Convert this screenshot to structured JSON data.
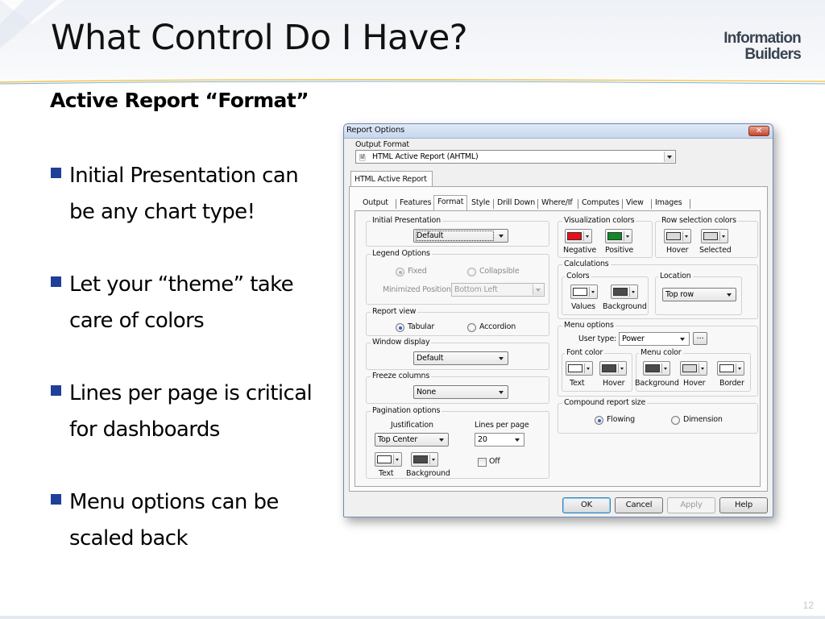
{
  "slide": {
    "title": "What Control Do I Have?",
    "subtitle": "Active Report “Format”",
    "logo_line1": "Information",
    "logo_line2": "Builders",
    "page_number": "12",
    "bullets": [
      {
        "line1": "Initial Presentation can",
        "line2": "be any chart type!"
      },
      {
        "line1": "Let your “theme” take",
        "line2": "care of colors"
      },
      {
        "line1": "Lines per page is critical",
        "line2": "for dashboards"
      },
      {
        "line1": "Menu options can be",
        "line2": "scaled back"
      }
    ]
  },
  "dialog": {
    "title": "Report Options",
    "output_format_label": "Output Format",
    "output_format_value": "HTML Active Report (AHTML)",
    "outer_tab": "HTML Active Report",
    "tabs": [
      "Output",
      "Features",
      "Format",
      "Style",
      "Drill Down",
      "Where/If",
      "Computes",
      "View",
      "Images"
    ],
    "selected_tab": "Format",
    "initial_presentation": {
      "title": "Initial Presentation",
      "value": "Default"
    },
    "legend_options": {
      "title": "Legend Options",
      "fixed": "Fixed",
      "collapsible": "Collapsible",
      "min_pos_label": "Minimized Position:",
      "min_pos_value": "Bottom Left"
    },
    "report_view": {
      "title": "Report view",
      "tabular": "Tabular",
      "accordion": "Accordion"
    },
    "window_display": {
      "title": "Window display",
      "value": "Default"
    },
    "freeze_columns": {
      "title": "Freeze columns",
      "value": "None"
    },
    "pagination": {
      "title": "Pagination options",
      "justification_label": "Justification",
      "justification_value": "Top Center",
      "lines_label": "Lines per page",
      "lines_value": "20",
      "text": "Text",
      "background": "Background",
      "off": "Off"
    },
    "visualization_colors": {
      "title": "Visualization colors",
      "negative": "Negative",
      "positive": "Positive"
    },
    "row_selection_colors": {
      "title": "Row selection colors",
      "hover": "Hover",
      "selected": "Selected"
    },
    "calculations": {
      "title": "Calculations",
      "colors_title": "Colors",
      "values": "Values",
      "background": "Background",
      "location_title": "Location",
      "location_value": "Top row"
    },
    "menu_options": {
      "title": "Menu options",
      "user_type_label": "User type:",
      "user_type_value": "Power",
      "ellipsis": "...",
      "font_color_title": "Font color",
      "menu_color_title": "Menu color",
      "text": "Text",
      "hover": "Hover",
      "background": "Background",
      "hover2": "Hover",
      "border": "Border"
    },
    "compound": {
      "title": "Compound report size",
      "flowing": "Flowing",
      "dimension": "Dimension"
    },
    "buttons": {
      "ok": "OK",
      "cancel": "Cancel",
      "apply": "Apply",
      "help": "Help"
    },
    "close_glyph": "✕",
    "colors": {
      "negative": "#e8101a",
      "positive": "#108a25",
      "dark": "#4a4a4a",
      "white": "#ffffff",
      "light": "#d9d9d9"
    }
  }
}
